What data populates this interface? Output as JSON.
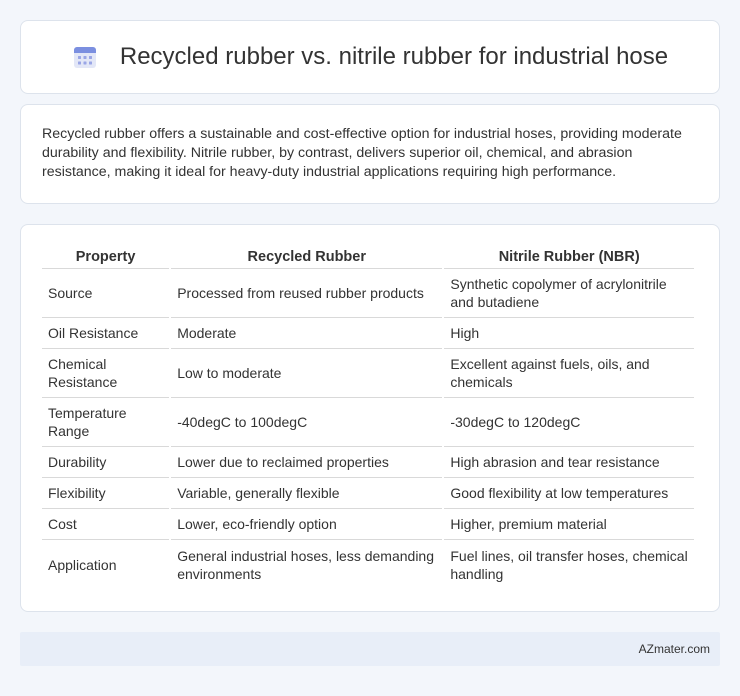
{
  "header": {
    "title": "Recycled rubber vs. nitrile rubber for industrial hose",
    "icon": "calendar-icon"
  },
  "intro": {
    "text": "Recycled rubber offers a sustainable and cost-effective option for industrial hoses, providing moderate durability and flexibility. Nitrile rubber, by contrast, delivers superior oil, chemical, and abrasion resistance, making it ideal for heavy-duty industrial applications requiring high performance."
  },
  "table": {
    "headers": [
      "Property",
      "Recycled Rubber",
      "Nitrile Rubber (NBR)"
    ],
    "rows": [
      [
        "Source",
        "Processed from reused rubber products",
        "Synthetic copolymer of acrylonitrile and butadiene"
      ],
      [
        "Oil Resistance",
        "Moderate",
        "High"
      ],
      [
        "Chemical Resistance",
        "Low to moderate",
        "Excellent against fuels, oils, and chemicals"
      ],
      [
        "Temperature Range",
        "-40degC to 100degC",
        "-30degC to 120degC"
      ],
      [
        "Durability",
        "Lower due to reclaimed properties",
        "High abrasion and tear resistance"
      ],
      [
        "Flexibility",
        "Variable, generally flexible",
        "Good flexibility at low temperatures"
      ],
      [
        "Cost",
        "Lower, eco-friendly option",
        "Higher, premium material"
      ],
      [
        "Application",
        "General industrial hoses, less demanding environments",
        "Fuel lines, oil transfer hoses, chemical handling"
      ]
    ]
  },
  "footer": {
    "brand": "AZmater.com"
  }
}
